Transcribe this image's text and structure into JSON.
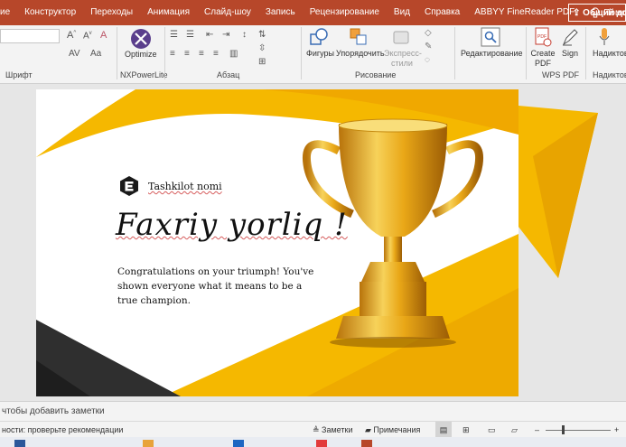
{
  "tabs": [
    "ие",
    "Конструктор",
    "Переходы",
    "Анимация",
    "Слайд-шоу",
    "Запись",
    "Рецензирование",
    "Вид",
    "Справка",
    "ABBYY FineReader PDF"
  ],
  "tell_me": "Помощь",
  "share": "Общий доступ",
  "ribbon": {
    "font_group": "Шрифт",
    "nxpower_button": "Optimize",
    "nxpower_group": "NXPowerLite",
    "paragraph_group": "Абзац",
    "shapes": "Фигуры",
    "arrange": "Упорядочить",
    "quick_styles": "Экспресс-стили",
    "drawing_group": "Рисование",
    "editing": "Редактирование",
    "create_pdf": "Create PDF",
    "sign": "Sign",
    "wps_group": "WPS PDF",
    "dictate_button": "Надиктовать",
    "dictate_group": "Надиктовать"
  },
  "slide": {
    "org_name": "Tashkilot nomi",
    "title": "Faxriy yorliq !",
    "body": "Congratulations on your triumph! You've shown everyone what it means to be a true champion."
  },
  "notes_placeholder": "чтобы добавить заметки",
  "status": {
    "accessibility": "ности: проверьте рекомендации",
    "notes": "Заметки",
    "comments": "Примечания"
  },
  "colors": {
    "accent": "#b7472a",
    "gold": "#f5b800"
  }
}
